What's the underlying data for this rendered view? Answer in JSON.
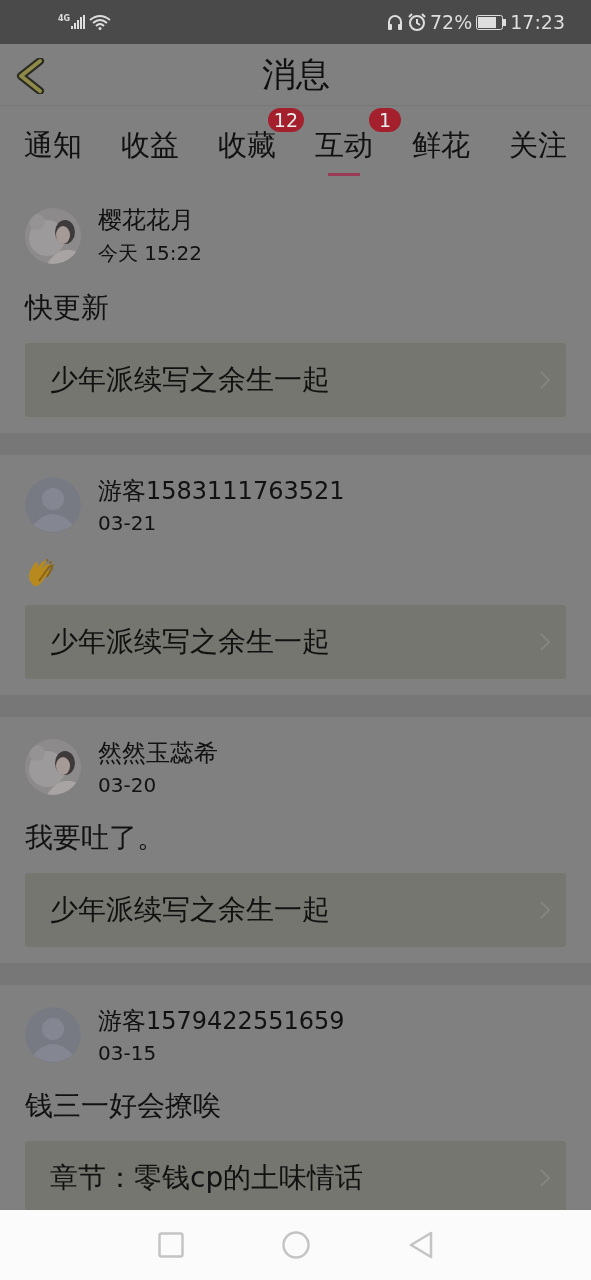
{
  "status_bar": {
    "network": "4G",
    "battery": "72%",
    "time": "17:23"
  },
  "header": {
    "title": "消息"
  },
  "tabs": [
    {
      "label": "通知",
      "selected": false
    },
    {
      "label": "收益",
      "selected": false
    },
    {
      "label": "收藏",
      "selected": false,
      "badge": "12"
    },
    {
      "label": "互动",
      "selected": true,
      "badge": "1"
    },
    {
      "label": "鲜花",
      "selected": false
    },
    {
      "label": "关注",
      "selected": false
    }
  ],
  "messages": [
    {
      "user": "樱花花月",
      "time": "今天 15:22",
      "comment": {
        "kind": "text",
        "text": "快更新"
      },
      "book": "少年派续写之余生一起"
    },
    {
      "user": "游客1583111763521",
      "avatar": {
        "kind": "default"
      },
      "time": "03-21",
      "comment": {
        "kind": "clap"
      },
      "book": "少年派续写之余生一起"
    },
    {
      "user": "然然玉蕊希",
      "time": "03-20",
      "comment": {
        "kind": "text",
        "text": "我要吐了。"
      },
      "book": "少年派续写之余生一起"
    },
    {
      "user": "游客1579422551659",
      "avatar": {
        "kind": "default"
      },
      "time": "03-15",
      "comment": {
        "kind": "text",
        "text": "钱三一好会撩唉"
      },
      "book": "章节：零钱cp的土味情话"
    }
  ]
}
